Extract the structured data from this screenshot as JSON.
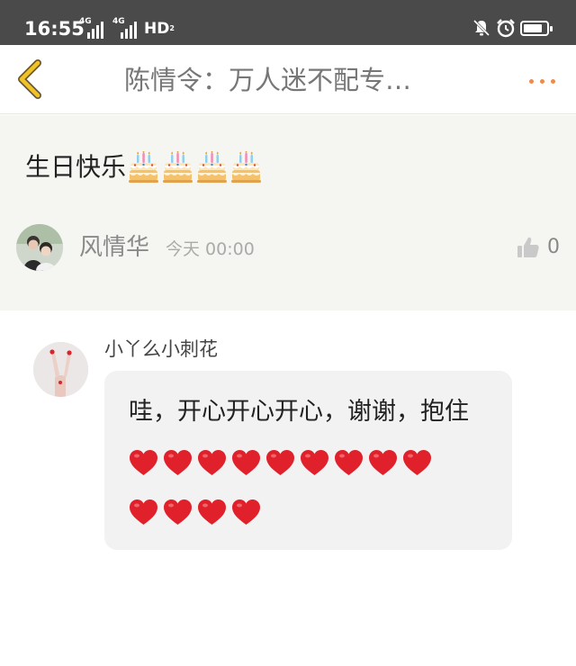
{
  "status_bar": {
    "time": "16:55",
    "network_1": "4G",
    "network_2": "4G",
    "hd": "HD",
    "hd_sub": "2",
    "icons": [
      "signal-icon",
      "signal-icon",
      "mute-icon",
      "alarm-icon",
      "battery-icon"
    ]
  },
  "nav": {
    "back_icon": "chevron-left-icon",
    "title": "陈情令：万人迷不配专…",
    "more_icon": "more-dots-icon",
    "accent_color": "#f08a4b"
  },
  "post": {
    "text": "生日快乐",
    "emoji": [
      "birthday-cake-icon",
      "birthday-cake-icon",
      "birthday-cake-icon",
      "birthday-cake-icon"
    ],
    "author": "风情华",
    "time": "今天 00:00",
    "like_icon": "thumbs-up-icon",
    "like_count": "0"
  },
  "reply": {
    "author": "小丫么小刺花",
    "text": "哇，开心开心开心，谢谢，抱住",
    "heart_rows": [
      9,
      4
    ],
    "heart_icon": "red-heart-icon",
    "heart_color": "#e0202a"
  }
}
